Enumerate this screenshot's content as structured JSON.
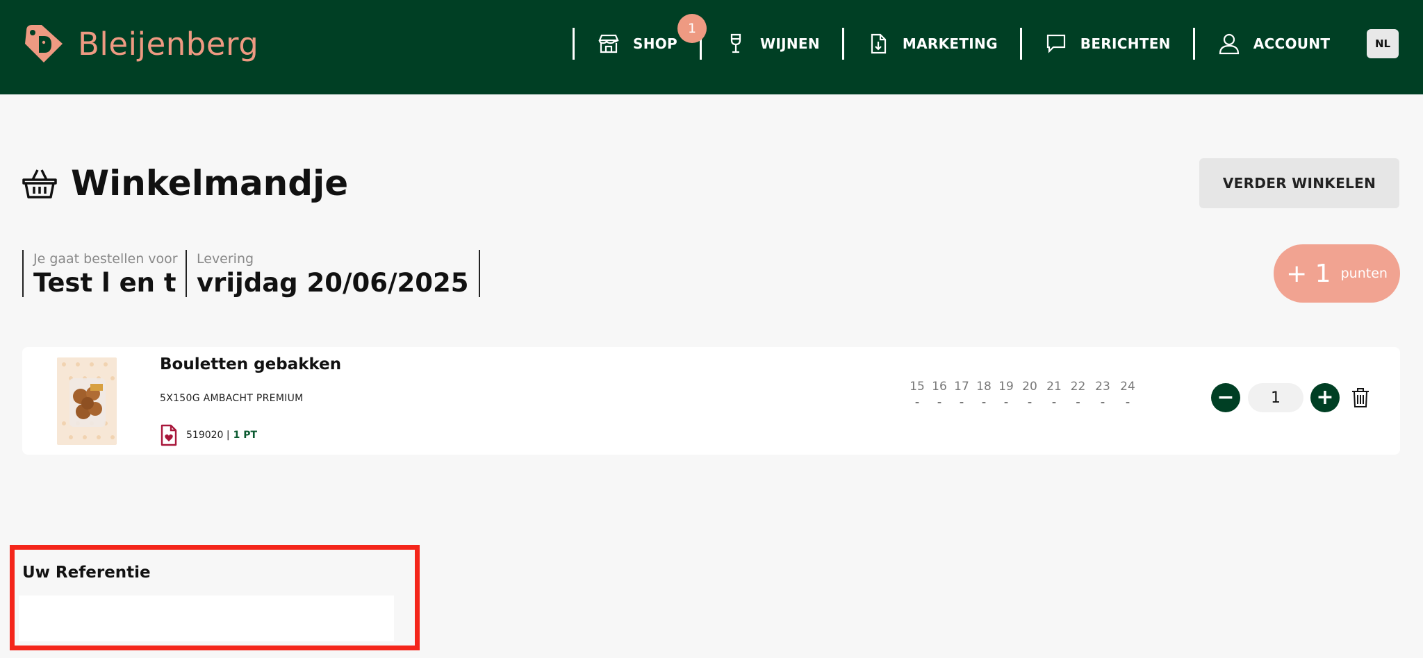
{
  "brand": {
    "name": "Bleijenberg",
    "accent": "#ee9a82",
    "header_bg": "#003f24"
  },
  "nav": {
    "items": [
      {
        "label": "SHOP",
        "icon": "shop-icon",
        "badge": "1"
      },
      {
        "label": "WIJNEN",
        "icon": "wine-glass-icon"
      },
      {
        "label": "MARKETING",
        "icon": "document-download-icon"
      },
      {
        "label": "BERICHTEN",
        "icon": "message-icon"
      },
      {
        "label": "ACCOUNT",
        "icon": "user-icon"
      }
    ],
    "language": "NL"
  },
  "page": {
    "title": "Winkelmandje",
    "continue_label": "VERDER WINKELEN"
  },
  "order_info": {
    "for_caption": "Je gaat bestellen voor",
    "for_value": "Test l en t",
    "delivery_caption": "Levering",
    "delivery_value": "vrijdag 20/06/2025"
  },
  "points": {
    "amount": "+ 1",
    "label": "punten"
  },
  "cart": {
    "items": [
      {
        "name": "Bouletten gebakken",
        "subtitle": "5X150G AMBACHT PREMIUM",
        "code": "519020 |",
        "points": "1 PT",
        "days": [
          {
            "day": "15",
            "value": "-"
          },
          {
            "day": "16",
            "value": "-"
          },
          {
            "day": "17",
            "value": "-"
          },
          {
            "day": "18",
            "value": "-"
          },
          {
            "day": "19",
            "value": "-"
          },
          {
            "day": "20",
            "value": "-"
          },
          {
            "day": "21",
            "value": "-"
          },
          {
            "day": "22",
            "value": "-"
          },
          {
            "day": "23",
            "value": "-"
          },
          {
            "day": "24",
            "value": "-"
          }
        ],
        "quantity": "1",
        "minus_symbol": "−",
        "plus_symbol": "+"
      }
    ]
  },
  "reference": {
    "label": "Uw Referentie",
    "value": "",
    "highlight_color": "#f4261b"
  }
}
